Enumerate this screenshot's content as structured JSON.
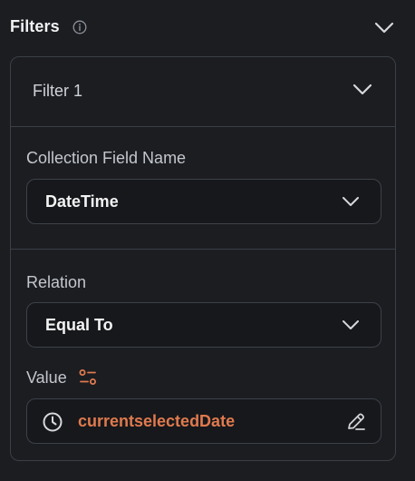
{
  "header": {
    "title": "Filters",
    "icons": {
      "info": "info-icon",
      "collapse": "chevron-down-icon"
    }
  },
  "filter": {
    "title": "Filter 1",
    "collection_field": {
      "label": "Collection Field Name",
      "value": "DateTime"
    },
    "relation": {
      "label": "Relation",
      "value": "Equal To"
    },
    "value": {
      "label": "Value",
      "variable": "currentselectedDate",
      "icons": {
        "source": "variable-source-icon",
        "type": "clock-icon",
        "edit": "edit-pencil-icon"
      }
    }
  },
  "colors": {
    "background": "#1b1d21",
    "border": "#3b3f47",
    "accent": "#e07a4e",
    "text": "#f3f3f3"
  }
}
